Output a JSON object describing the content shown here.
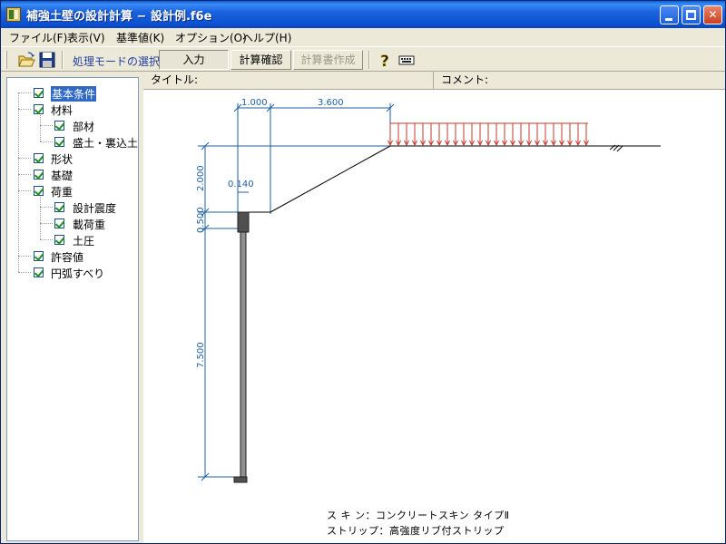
{
  "window": {
    "title": "補強土壁の設計計算 − 設計例.f6e"
  },
  "menu": {
    "items": [
      {
        "label": "ファイル(F)"
      },
      {
        "label": "表示(V)"
      },
      {
        "label": "基準値(K)"
      },
      {
        "label": "オプション(O)"
      },
      {
        "label": "ヘルプ(H)"
      }
    ]
  },
  "toolbar": {
    "mode_label": "処理モードの選択",
    "modes": [
      {
        "label": "入力",
        "state": "active"
      },
      {
        "label": "計算確認",
        "state": "normal"
      },
      {
        "label": "計算書作成",
        "state": "disabled"
      }
    ],
    "icons": [
      "open-folder-icon",
      "save-disk-icon",
      "help-icon",
      "keyboard-icon"
    ]
  },
  "tree": {
    "items": [
      {
        "label": "基本条件",
        "level": 0,
        "checked": true,
        "selected": true
      },
      {
        "label": "材料",
        "level": 0,
        "checked": true
      },
      {
        "label": "部材",
        "level": 1,
        "checked": true
      },
      {
        "label": "盛土・裏込土",
        "level": 1,
        "checked": true
      },
      {
        "label": "形状",
        "level": 0,
        "checked": true
      },
      {
        "label": "基礎",
        "level": 0,
        "checked": true
      },
      {
        "label": "荷重",
        "level": 0,
        "checked": true
      },
      {
        "label": "設計震度",
        "level": 1,
        "checked": true
      },
      {
        "label": "載荷重",
        "level": 1,
        "checked": true
      },
      {
        "label": "土圧",
        "level": 1,
        "checked": true
      },
      {
        "label": "許容値",
        "level": 0,
        "checked": true
      },
      {
        "label": "円弧すべり",
        "level": 0,
        "checked": true
      }
    ]
  },
  "header": {
    "title_label": "タイトル:",
    "comment_label": "コメント:"
  },
  "drawing": {
    "dimensions": {
      "top_left": "1.000",
      "top_right": "3.600",
      "height_slope": "2.000",
      "height_cap": "0.500",
      "height_wall": "7.500",
      "cap_width": "0.140"
    },
    "load_color": "#c0392b",
    "dim_color": "#1f5fa0",
    "notes": [
      "ス  キ  ン：コンクリートスキン  タイプⅡ",
      "ストリップ：高強度リブ付ストリップ"
    ]
  }
}
